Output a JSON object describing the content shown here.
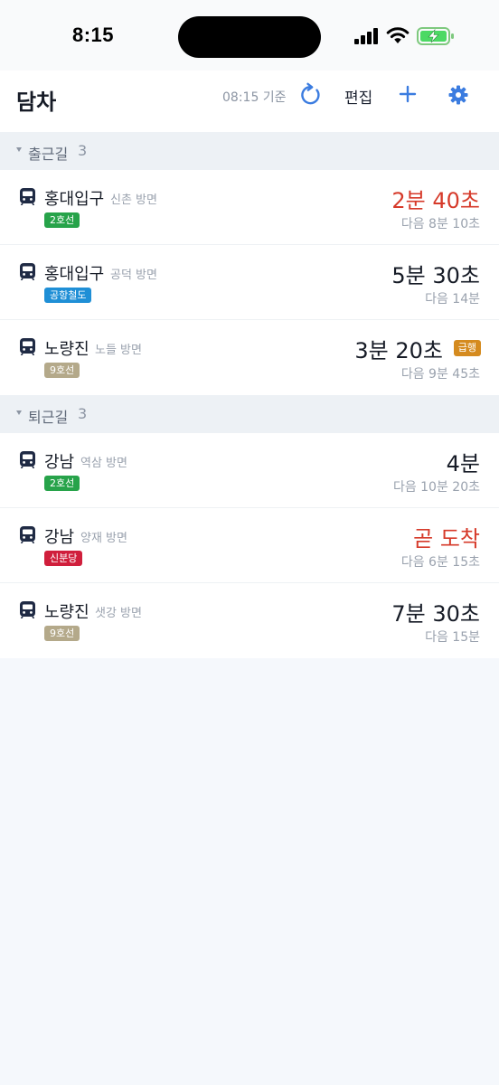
{
  "status_bar": {
    "time": "8:15"
  },
  "header": {
    "title": "담차",
    "updated_at": "08:15 기준",
    "edit_label": "편집",
    "refresh_icon": "refresh-icon",
    "add_icon": "plus-icon",
    "settings_icon": "gear-icon",
    "accent_color": "#3b7ce0"
  },
  "sections": [
    {
      "title": "출근길",
      "count": "3",
      "rows": [
        {
          "station": "홍대입구",
          "direction": "신촌 방면",
          "line": "2호선",
          "line_color": "#27a34a",
          "arrival": "2분 40초",
          "next": "다음 8분 10초",
          "urgent": true
        },
        {
          "station": "홍대입구",
          "direction": "공덕 방면",
          "line": "공항철도",
          "line_color": "#1f8fd6",
          "arrival": "5분 30초",
          "next": "다음 14분",
          "urgent": false
        },
        {
          "station": "노량진",
          "direction": "노들 방면",
          "line": "9호선",
          "line_color": "#b4a98a",
          "arrival": "3분 20초",
          "next": "다음 9분 45초",
          "urgent": false,
          "badge": "급행",
          "badge_color": "#d58b1f"
        }
      ]
    },
    {
      "title": "퇴근길",
      "count": "3",
      "rows": [
        {
          "station": "강남",
          "direction": "역삼 방면",
          "line": "2호선",
          "line_color": "#27a34a",
          "arrival": "4분",
          "next": "다음 10분 20초",
          "urgent": false
        },
        {
          "station": "강남",
          "direction": "양재 방면",
          "line": "신분당",
          "line_color": "#d01f3c",
          "arrival": "곧 도착",
          "next": "다음 6분 15초",
          "urgent": true
        },
        {
          "station": "노량진",
          "direction": "샛강 방면",
          "line": "9호선",
          "line_color": "#b4a98a",
          "arrival": "7분 30초",
          "next": "다음 15분",
          "urgent": false
        }
      ]
    }
  ]
}
